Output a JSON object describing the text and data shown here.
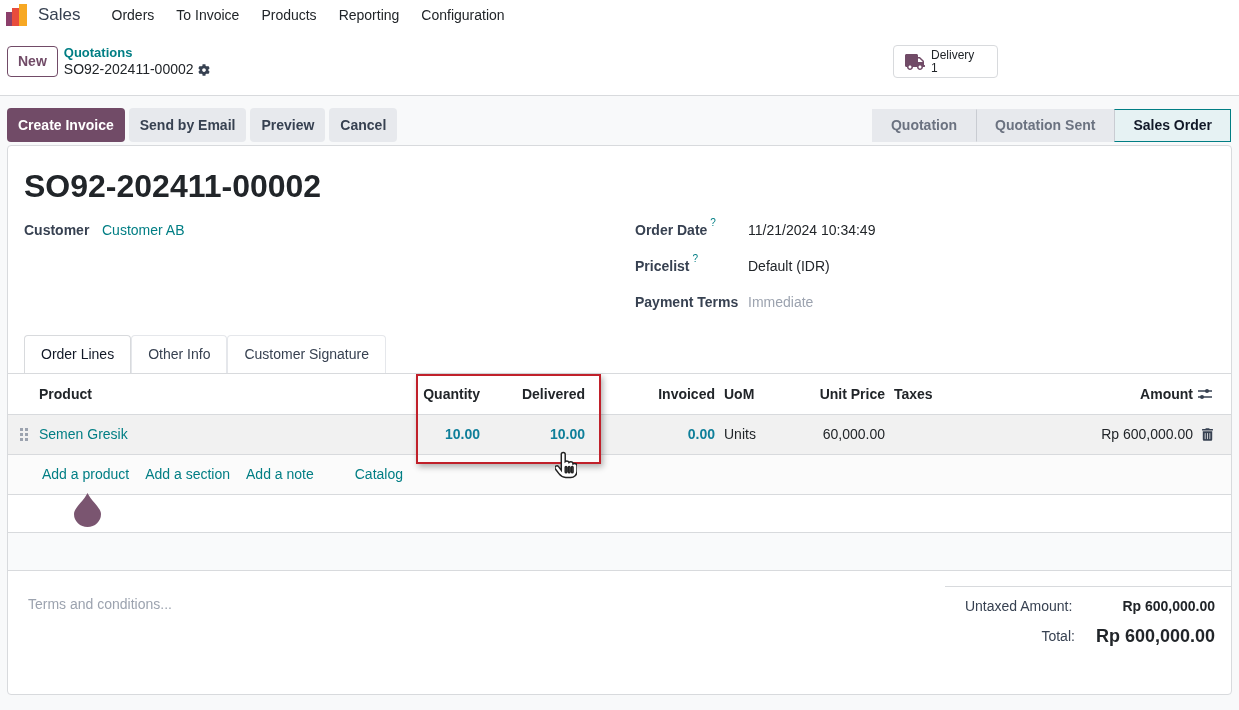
{
  "app": {
    "name": "Sales",
    "menu": [
      "Orders",
      "To Invoice",
      "Products",
      "Reporting",
      "Configuration"
    ]
  },
  "control_panel": {
    "new_button": "New",
    "breadcrumb": "Quotations",
    "record": "SO92-202411-00002",
    "smart_button": {
      "label": "Delivery",
      "count": "1"
    }
  },
  "actions": [
    {
      "label": "Create Invoice",
      "kind": "primary"
    },
    {
      "label": "Send by Email",
      "kind": "secondary"
    },
    {
      "label": "Preview",
      "kind": "secondary"
    },
    {
      "label": "Cancel",
      "kind": "secondary"
    }
  ],
  "statusbar": [
    {
      "label": "Quotation",
      "selected": false
    },
    {
      "label": "Quotation Sent",
      "selected": false
    },
    {
      "label": "Sales Order",
      "selected": true
    }
  ],
  "form": {
    "title": "SO92-202411-00002",
    "customer": {
      "label": "Customer",
      "value": "Customer AB"
    },
    "right_fields": [
      {
        "label": "Order Date",
        "help": "?",
        "value": "11/21/2024 10:34:49"
      },
      {
        "label": "Pricelist",
        "help": "?",
        "value": "Default (IDR)"
      },
      {
        "label": "Payment Terms",
        "placeholder": "Immediate"
      }
    ]
  },
  "tabs": [
    {
      "label": "Order Lines",
      "selected": true
    },
    {
      "label": "Other Info",
      "selected": false
    },
    {
      "label": "Customer Signature",
      "selected": false
    }
  ],
  "table": {
    "columns": [
      "Product",
      "Quantity",
      "Delivered",
      "Invoiced",
      "UoM",
      "Unit Price",
      "Taxes",
      "Amount"
    ],
    "rows": [
      {
        "product": "Semen Gresik",
        "quantity": "10.00",
        "delivered": "10.00",
        "invoiced": "0.00",
        "uom": "Units",
        "unit_price": "60,000.00",
        "amount": "Rp 600,000.00"
      }
    ],
    "add_links": [
      "Add a product",
      "Add a section",
      "Add a note",
      "Catalog"
    ]
  },
  "terms": {
    "placeholder": "Terms and conditions..."
  },
  "totals": [
    {
      "label": "Untaxed Amount:",
      "value": "Rp 600,000.00",
      "kind": "subtotal"
    },
    {
      "label": "Total:",
      "value": "Rp 600,000.00",
      "kind": "total"
    }
  ]
}
